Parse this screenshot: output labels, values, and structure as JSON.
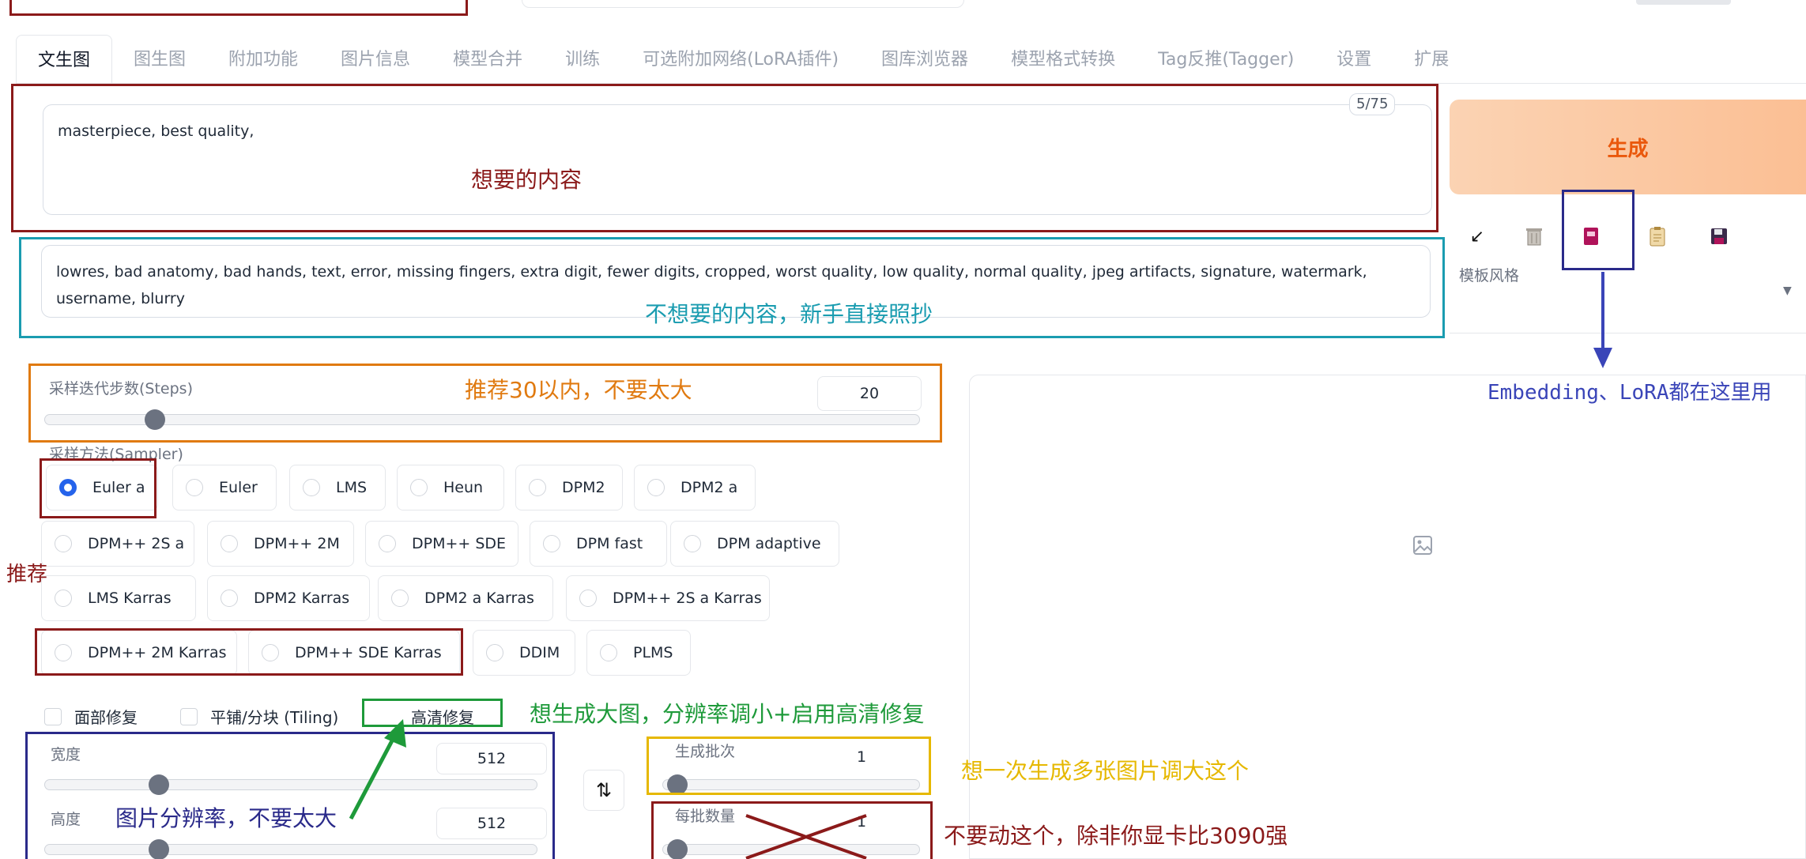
{
  "tabs": [
    "文生图",
    "图生图",
    "附加功能",
    "图片信息",
    "模型合并",
    "训练",
    "可选附加网络(LoRA插件)",
    "图库浏览器",
    "模型格式转换",
    "Tag反推(Tagger)",
    "设置",
    "扩展"
  ],
  "prompt": {
    "positive": "masterpiece, best quality,",
    "token_count": "5/75",
    "negative_line1": "lowres, bad anatomy, bad hands, text, error, missing fingers, extra digit, fewer digits, cropped, worst quality, low quality, normal quality, jpeg artifacts, signature, watermark,",
    "negative_line2": "username, blurry"
  },
  "generate": {
    "label": "生成",
    "template_label": "模板风格"
  },
  "tools": [
    "arrow-diagonal-icon",
    "trash-icon",
    "card-icon",
    "clipboard-icon",
    "save-icon"
  ],
  "steps": {
    "label": "采样迭代步数(Steps)",
    "value": "20",
    "fraction": 0.2
  },
  "sampler": {
    "label": "采样方法(Sampler)",
    "selected": "Euler a",
    "rows": [
      [
        "Euler a",
        "Euler",
        "LMS",
        "Heun",
        "DPM2",
        "DPM2 a"
      ],
      [
        "DPM++ 2S a",
        "DPM++ 2M",
        "DPM++ SDE",
        "DPM fast",
        "DPM adaptive"
      ],
      [
        "LMS Karras",
        "DPM2 Karras",
        "DPM2 a Karras",
        "DPM++ 2S a Karras"
      ],
      [
        "DPM++ 2M Karras",
        "DPM++ SDE Karras",
        "DDIM",
        "PLMS"
      ]
    ]
  },
  "options": {
    "face": "面部修复",
    "tiling": "平铺/分块 (Tiling)",
    "hires": "高清修复"
  },
  "size": {
    "width_label": "宽度",
    "width_value": "512",
    "height_label": "高度",
    "height_value": "512"
  },
  "batch": {
    "count_label": "生成批次",
    "count_value": "1",
    "size_label": "每批数量",
    "size_value": "1"
  },
  "annotations": {
    "positive": "想要的内容",
    "negative": "不想要的内容，新手直接照抄",
    "embedding": "Embedding、LoRA都在这里用",
    "steps": "推荐30以内，不要太大",
    "recommend": "推荐",
    "hires": "想生成大图，分辨率调小+启用高清修复",
    "resolution": "图片分辨率，不要太大",
    "batch_count": "想一次生成多张图片调大这个",
    "batch_size": "不要动这个，除非你显卡比3090强"
  },
  "colors": {
    "annotation_red": "#8b1a1a",
    "annotation_cyan": "#1a9cb0",
    "annotation_navy": "#2a2a8a",
    "annotation_orange": "#e07a10",
    "annotation_green": "#1e9a3a",
    "annotation_gold": "#e6b800",
    "annotation_blue": "#3a45b8",
    "accent_blue": "#2563eb",
    "generate_orange": "#ea580c"
  }
}
